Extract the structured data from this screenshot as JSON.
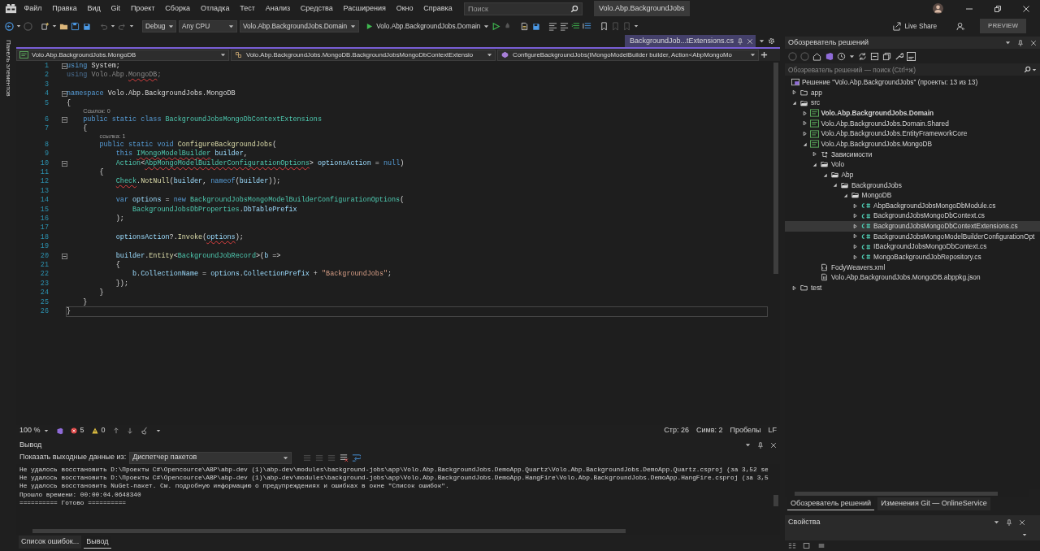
{
  "menu": [
    "Файл",
    "Правка",
    "Вид",
    "Git",
    "Проект",
    "Сборка",
    "Отладка",
    "Тест",
    "Анализ",
    "Средства",
    "Расширения",
    "Окно",
    "Справка"
  ],
  "search": {
    "placeholder": "Поиск"
  },
  "solution_badge": "Volo.Abp.BackgroundJobs",
  "live_share": "Live Share",
  "preview": "PREVIEW",
  "toolbar": {
    "configuration": "Debug",
    "platform": "Any CPU",
    "startup_project": "Volo.Abp.BackgroundJobs.Domain",
    "run_target": "Volo.Abp.BackgroundJobs.Domain"
  },
  "toolbox_label": "Панель элементов",
  "editor": {
    "tabs": [
      {
        "label": "BackgroundJob...tExtensions.cs",
        "selected": true
      }
    ],
    "nav": [
      "Volo.Abp.BackgroundJobs.MongoDB",
      "Volo.Abp.BackgroundJobs.MongoDB.BackgroundJobsMongoDbContextExtensio",
      "ConfigureBackgroundJobs(IMongoModelBuilder builder, Action<AbpMongoMo"
    ],
    "lines": [
      {
        "kind": "code",
        "number": "1",
        "fold": true,
        "tokens": [
          {
            "t": "using",
            "kind": "kw"
          },
          {
            "t": " System;",
            "kind": "plain"
          }
        ]
      },
      {
        "kind": "code",
        "number": "2",
        "tokens": [
          {
            "t": "using",
            "kind": "faded-kw"
          },
          {
            "t": " Volo.Abp.",
            "kind": "faded"
          },
          {
            "t": "MongoDB",
            "kind": "faded",
            "error": true
          },
          {
            "t": ";",
            "kind": "faded"
          }
        ]
      },
      {
        "kind": "code",
        "number": "3"
      },
      {
        "kind": "code",
        "number": "4",
        "fold": true,
        "tokens": [
          {
            "t": "namespace",
            "kind": "kw"
          },
          {
            "t": " Volo.Abp.BackgroundJobs.MongoDB",
            "kind": "plain"
          }
        ]
      },
      {
        "kind": "code",
        "number": "5",
        "tokens": [
          {
            "t": "{",
            "kind": "plain"
          }
        ]
      },
      {
        "kind": "lens",
        "text": "Ссылок: 0"
      },
      {
        "kind": "code",
        "number": "6",
        "fold": true,
        "tokens": [
          {
            "t": "    public static class",
            "kind": "kw"
          },
          {
            "t": " BackgroundJobsMongoDbContextExtensions",
            "kind": "type"
          }
        ]
      },
      {
        "kind": "code",
        "number": "7",
        "tokens": [
          {
            "t": "    {",
            "kind": "plain"
          }
        ]
      },
      {
        "kind": "lens",
        "text": "ссылка: 1"
      },
      {
        "kind": "code",
        "number": "8",
        "tokens": [
          {
            "t": "        public static void",
            "kind": "kw"
          },
          {
            "t": " ConfigureBackgroundJobs",
            "kind": "method"
          },
          {
            "t": "(",
            "kind": "plain"
          }
        ]
      },
      {
        "kind": "code",
        "number": "9",
        "tokens": [
          {
            "t": "            this",
            "kind": "kw"
          },
          {
            "t": " IMongoModelBuilder",
            "kind": "type",
            "error": true
          },
          {
            "t": " builder",
            "kind": "var"
          },
          {
            "t": ",",
            "kind": "plain"
          }
        ]
      },
      {
        "kind": "code",
        "number": "10",
        "fold": true,
        "tokens": [
          {
            "t": "            Action",
            "kind": "type"
          },
          {
            "t": "<",
            "kind": "plain"
          },
          {
            "t": "AbpMongoModelBuilderConfigurationOptions",
            "kind": "type",
            "error": true
          },
          {
            "t": "> ",
            "kind": "plain"
          },
          {
            "t": "optionsAction",
            "kind": "var"
          },
          {
            "t": " = ",
            "kind": "plain"
          },
          {
            "t": "null",
            "kind": "kw"
          },
          {
            "t": ")",
            "kind": "plain"
          }
        ]
      },
      {
        "kind": "code",
        "number": "11",
        "tokens": [
          {
            "t": "        {",
            "kind": "plain"
          }
        ]
      },
      {
        "kind": "code",
        "number": "12",
        "tokens": [
          {
            "t": "            Check",
            "kind": "type",
            "error": true
          },
          {
            "t": ".",
            "kind": "plain"
          },
          {
            "t": "NotNull",
            "kind": "method"
          },
          {
            "t": "(",
            "kind": "plain"
          },
          {
            "t": "builder",
            "kind": "var"
          },
          {
            "t": ", ",
            "kind": "plain"
          },
          {
            "t": "nameof",
            "kind": "kw"
          },
          {
            "t": "(",
            "kind": "plain"
          },
          {
            "t": "builder",
            "kind": "var"
          },
          {
            "t": "));",
            "kind": "plain"
          }
        ]
      },
      {
        "kind": "code",
        "number": "13"
      },
      {
        "kind": "code",
        "number": "14",
        "tokens": [
          {
            "t": "            var",
            "kind": "kw"
          },
          {
            "t": " options",
            "kind": "var"
          },
          {
            "t": " = ",
            "kind": "plain"
          },
          {
            "t": "new",
            "kind": "kw"
          },
          {
            "t": " BackgroundJobsMongoModelBuilderConfigurationOptions",
            "kind": "type"
          },
          {
            "t": "(",
            "kind": "plain"
          }
        ]
      },
      {
        "kind": "code",
        "number": "15",
        "tokens": [
          {
            "t": "                BackgroundJobsDbProperties",
            "kind": "type"
          },
          {
            "t": ".",
            "kind": "plain"
          },
          {
            "t": "DbTablePrefix",
            "kind": "var"
          }
        ]
      },
      {
        "kind": "code",
        "number": "16",
        "tokens": [
          {
            "t": "            );",
            "kind": "plain"
          }
        ]
      },
      {
        "kind": "code",
        "number": "17"
      },
      {
        "kind": "code",
        "number": "18",
        "tokens": [
          {
            "t": "            optionsAction",
            "kind": "var"
          },
          {
            "t": "?.",
            "kind": "plain"
          },
          {
            "t": "Invoke",
            "kind": "method"
          },
          {
            "t": "(",
            "kind": "plain"
          },
          {
            "t": "options",
            "kind": "var",
            "error": true
          },
          {
            "t": ");",
            "kind": "plain"
          }
        ]
      },
      {
        "kind": "code",
        "number": "19"
      },
      {
        "kind": "code",
        "number": "20",
        "fold": true,
        "tokens": [
          {
            "t": "            builder",
            "kind": "var"
          },
          {
            "t": ".",
            "kind": "plain"
          },
          {
            "t": "Entity",
            "kind": "method"
          },
          {
            "t": "<",
            "kind": "plain"
          },
          {
            "t": "BackgroundJobRecord",
            "kind": "type"
          },
          {
            "t": ">(",
            "kind": "plain"
          },
          {
            "t": "b",
            "kind": "var"
          },
          {
            "t": " =>",
            "kind": "plain"
          }
        ]
      },
      {
        "kind": "code",
        "number": "21",
        "tokens": [
          {
            "t": "            {",
            "kind": "plain"
          }
        ]
      },
      {
        "kind": "code",
        "number": "22",
        "tokens": [
          {
            "t": "                b",
            "kind": "var"
          },
          {
            "t": ".",
            "kind": "plain"
          },
          {
            "t": "CollectionName",
            "kind": "var"
          },
          {
            "t": " = ",
            "kind": "plain"
          },
          {
            "t": "options",
            "kind": "var"
          },
          {
            "t": ".",
            "kind": "plain"
          },
          {
            "t": "CollectionPrefix",
            "kind": "var"
          },
          {
            "t": " + ",
            "kind": "plain"
          },
          {
            "t": "\"BackgroundJobs\"",
            "kind": "str"
          },
          {
            "t": ";",
            "kind": "plain"
          }
        ]
      },
      {
        "kind": "code",
        "number": "23",
        "tokens": [
          {
            "t": "            });",
            "kind": "plain"
          }
        ]
      },
      {
        "kind": "code",
        "number": "24",
        "tokens": [
          {
            "t": "        }",
            "kind": "plain"
          }
        ]
      },
      {
        "kind": "code",
        "number": "25",
        "tokens": [
          {
            "t": "    }",
            "kind": "plain"
          }
        ]
      },
      {
        "kind": "code",
        "number": "26",
        "current": true,
        "tokens": [
          {
            "t": "}",
            "kind": "plain"
          }
        ]
      }
    ],
    "status": {
      "zoom": "100 %",
      "errors": "5",
      "warnings": "0",
      "line": "Стр: 26",
      "column": "Симв: 2",
      "spaces": "Пробелы",
      "eol": "LF"
    }
  },
  "output": {
    "title": "Вывод",
    "source_label": "Показать выходные данные из:",
    "source": "Диспетчер пакетов",
    "lines": [
      "Не удалось восстановить D:\\Проекты C#\\Opencource\\ABP\\abp-dev (1)\\abp-dev\\modules\\background-jobs\\app\\Volo.Abp.BackgroundJobs.DemoApp.Quartz\\Volo.Abp.BackgroundJobs.DemoApp.Quartz.csproj (за 3,52 se",
      "Не удалось восстановить D:\\Проекты C#\\Opencource\\ABP\\abp-dev (1)\\abp-dev\\modules\\background-jobs\\app\\Volo.Abp.BackgroundJobs.DemoApp.HangFire\\Volo.Abp.BackgroundJobs.DemoApp.HangFire.csproj (за 3,5",
      "Не удалось восстановить NuGet-пакет. См. подробную информацию о предупреждениях и ошибках в окне \"Список ошибок\".",
      "Прошло времени: 00:00:04.0648340",
      "========== Готово =========="
    ]
  },
  "bottom_tabs": [
    {
      "label": "Список ошибок...",
      "selected": false
    },
    {
      "label": "Вывод",
      "selected": true
    }
  ],
  "solution_explorer": {
    "title": "Обозреватель решений",
    "search": {
      "placeholder": "Обозреватель решений — поиск (Ctrl+ж)"
    },
    "solution": "Решение \"Volo.Abp.BackgroundJobs\" (проекты: 13 из 13)",
    "tree": [
      {
        "label": "app",
        "kind": "folder",
        "expanded": false
      },
      {
        "label": "src",
        "kind": "folder",
        "expanded": true,
        "children": [
          {
            "label": "Volo.Abp.BackgroundJobs.Domain",
            "kind": "project",
            "bold": true,
            "expanded": false
          },
          {
            "label": "Volo.Abp.BackgroundJobs.Domain.Shared",
            "kind": "project",
            "expanded": false
          },
          {
            "label": "Volo.Abp.BackgroundJobs.EntityFrameworkCore",
            "kind": "project",
            "expanded": false
          },
          {
            "label": "Volo.Abp.BackgroundJobs.MongoDB",
            "kind": "project",
            "expanded": true,
            "children": [
              {
                "label": "Зависимости",
                "kind": "deps",
                "expanded": false
              },
              {
                "label": "Volo",
                "kind": "folder",
                "expanded": true,
                "children": [
                  {
                    "label": "Abp",
                    "kind": "folder",
                    "expanded": true,
                    "children": [
                      {
                        "label": "BackgroundJobs",
                        "kind": "folder",
                        "expanded": true,
                        "children": [
                          {
                            "label": "MongoDB",
                            "kind": "folder",
                            "expanded": true,
                            "children": [
                              {
                                "label": "AbpBackgroundJobsMongoDbModule.cs",
                                "kind": "csharp",
                                "expanded": false,
                                "selected": false
                              },
                              {
                                "label": "BackgroundJobsMongoDbContext.cs",
                                "kind": "csharp",
                                "expanded": false,
                                "selected": false
                              },
                              {
                                "label": "BackgroundJobsMongoDbContextExtensions.cs",
                                "kind": "csharp",
                                "expanded": false,
                                "selected": true
                              },
                              {
                                "label": "BackgroundJobsMongoModelBuilderConfigurationOpt",
                                "kind": "csharp",
                                "expanded": false,
                                "selected": false
                              },
                              {
                                "label": "IBackgroundJobsMongoDbContext.cs",
                                "kind": "csharp",
                                "expanded": false,
                                "selected": false
                              },
                              {
                                "label": "MongoBackgroundJobRepository.cs",
                                "kind": "csharp",
                                "expanded": false,
                                "selected": false
                              }
                            ]
                          }
                        ]
                      }
                    ]
                  }
                ]
              },
              {
                "label": "FodyWeavers.xml",
                "kind": "xml"
              },
              {
                "label": "Volo.Abp.BackgroundJobs.MongoDB.abppkg.json",
                "kind": "json"
              }
            ]
          }
        ]
      },
      {
        "label": "test",
        "kind": "folder",
        "expanded": false
      }
    ]
  },
  "right_tabs": [
    {
      "label": "Обозреватель решений",
      "selected": true
    },
    {
      "label": "Изменения Git — OnlineService",
      "selected": false
    }
  ],
  "properties": {
    "title": "Свойства"
  }
}
